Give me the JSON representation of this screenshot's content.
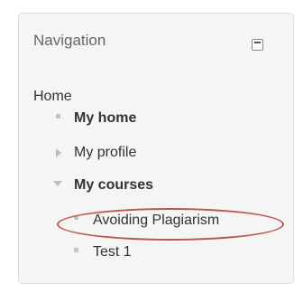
{
  "navigation": {
    "title": "Navigation",
    "collapse_icon": "minus-square-icon",
    "items": [
      {
        "label": "Home",
        "level": 0,
        "icon": "none"
      },
      {
        "label": "My home",
        "level": 1,
        "icon": "square-bullet-icon",
        "bold": true
      },
      {
        "label": "My profile",
        "level": 1,
        "icon": "triangle-right-icon"
      },
      {
        "label": "My courses",
        "level": 1,
        "icon": "triangle-down-icon",
        "bold": true
      },
      {
        "label": "Avoiding Plagiarism",
        "level": 2,
        "icon": "square-bullet-icon",
        "highlighted": true
      },
      {
        "label": "Test 1",
        "level": 2,
        "icon": "square-bullet-icon"
      }
    ],
    "highlight_color": "#b8574a"
  }
}
